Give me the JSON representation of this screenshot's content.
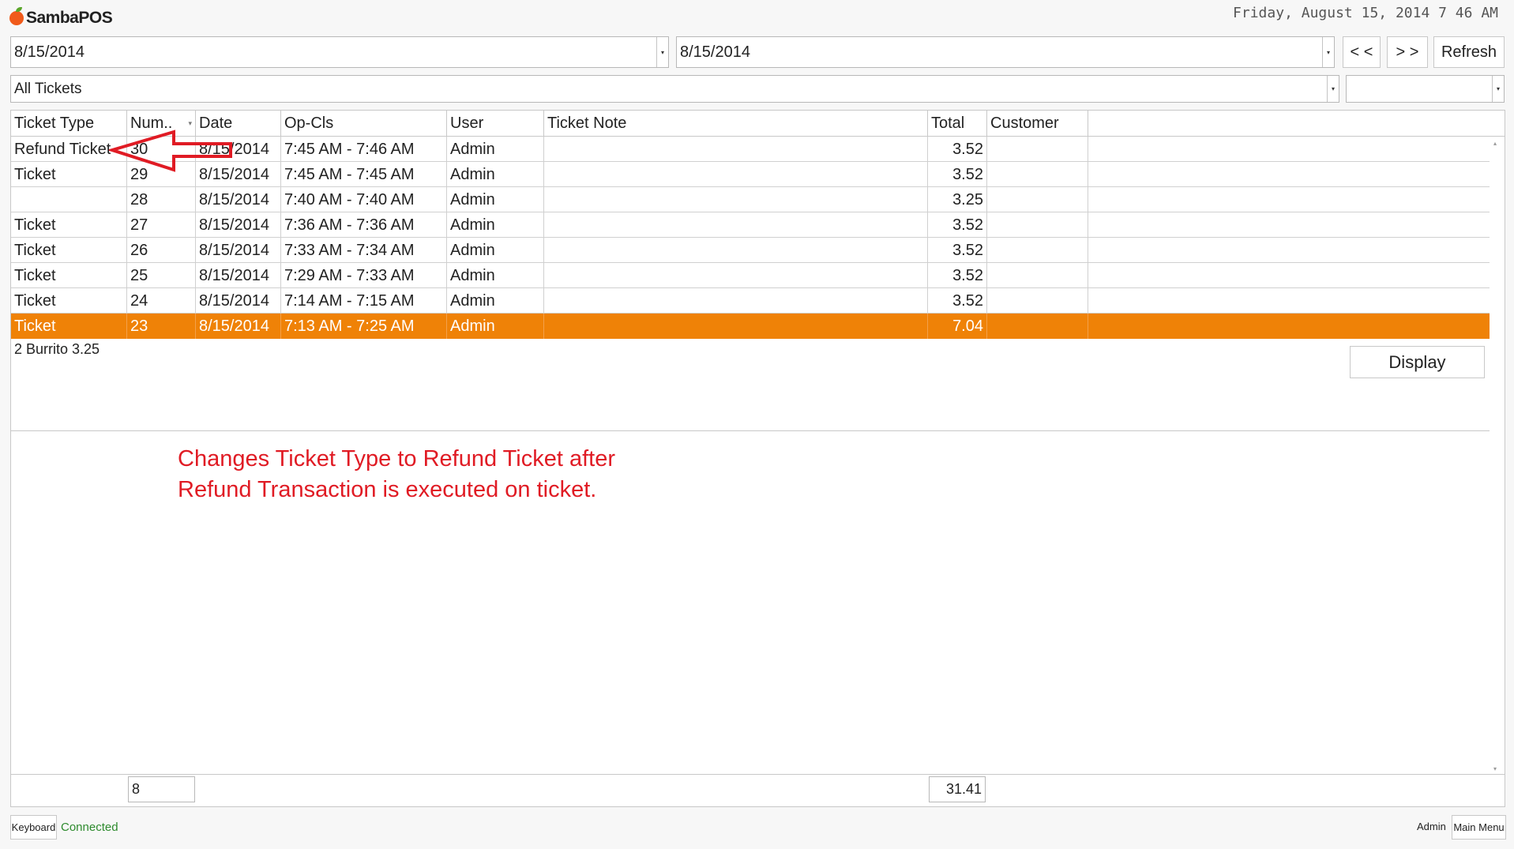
{
  "app": {
    "logo_text": "SambaPOS",
    "clock": "Friday, August 15, 2014 7 46 AM"
  },
  "filters": {
    "start_date": "8/15/2014",
    "end_date": "8/15/2014",
    "prev_label": "< <",
    "next_label": "> >",
    "refresh_label": "Refresh",
    "ticket_filter": "All Tickets",
    "secondary_filter": ""
  },
  "table": {
    "columns": [
      "Ticket Type",
      "Num..",
      "Date",
      "Op-Cls",
      "User",
      "Ticket Note",
      "Total",
      "Customer"
    ],
    "rows": [
      {
        "type": "Refund Ticket",
        "num": "30",
        "date": "8/15/2014",
        "opcls": "7:45 AM - 7:46 AM",
        "user": "Admin",
        "note": "",
        "total": "3.52",
        "customer": ""
      },
      {
        "type": "Ticket",
        "num": "29",
        "date": "8/15/2014",
        "opcls": "7:45 AM - 7:45 AM",
        "user": "Admin",
        "note": "",
        "total": "3.52",
        "customer": ""
      },
      {
        "type": "",
        "num": "28",
        "date": "8/15/2014",
        "opcls": "7:40 AM - 7:40 AM",
        "user": "Admin",
        "note": "",
        "total": "3.25",
        "customer": ""
      },
      {
        "type": "Ticket",
        "num": "27",
        "date": "8/15/2014",
        "opcls": "7:36 AM - 7:36 AM",
        "user": "Admin",
        "note": "",
        "total": "3.52",
        "customer": ""
      },
      {
        "type": "Ticket",
        "num": "26",
        "date": "8/15/2014",
        "opcls": "7:33 AM - 7:34 AM",
        "user": "Admin",
        "note": "",
        "total": "3.52",
        "customer": ""
      },
      {
        "type": "Ticket",
        "num": "25",
        "date": "8/15/2014",
        "opcls": "7:29 AM - 7:33 AM",
        "user": "Admin",
        "note": "",
        "total": "3.52",
        "customer": ""
      },
      {
        "type": "Ticket",
        "num": "24",
        "date": "8/15/2014",
        "opcls": "7:14 AM - 7:15 AM",
        "user": "Admin",
        "note": "",
        "total": "3.52",
        "customer": ""
      },
      {
        "type": "Ticket",
        "num": "23",
        "date": "8/15/2014",
        "opcls": "7:13 AM - 7:25 AM",
        "user": "Admin",
        "note": "",
        "total": "7.04",
        "customer": ""
      }
    ],
    "selected_row": 7,
    "detail_line": "2 Burrito 3.25",
    "display_label": "Display",
    "footer_count": "8",
    "footer_total": "31.41"
  },
  "annotation": {
    "line1": "Changes Ticket Type to Refund Ticket after",
    "line2": "Refund Transaction is executed on ticket."
  },
  "status": {
    "keyboard_label": "Keyboard",
    "connection": "Connected",
    "user": "Admin",
    "main_menu_label": "Main Menu"
  },
  "colors": {
    "selection": "#ef8207",
    "annotation": "#e01b24",
    "connected": "#2e8b2e"
  },
  "icons": [
    "samba-logo-icon",
    "dropdown-arrow-icon",
    "sort-arrow-icon",
    "annotation-arrow-icon"
  ]
}
